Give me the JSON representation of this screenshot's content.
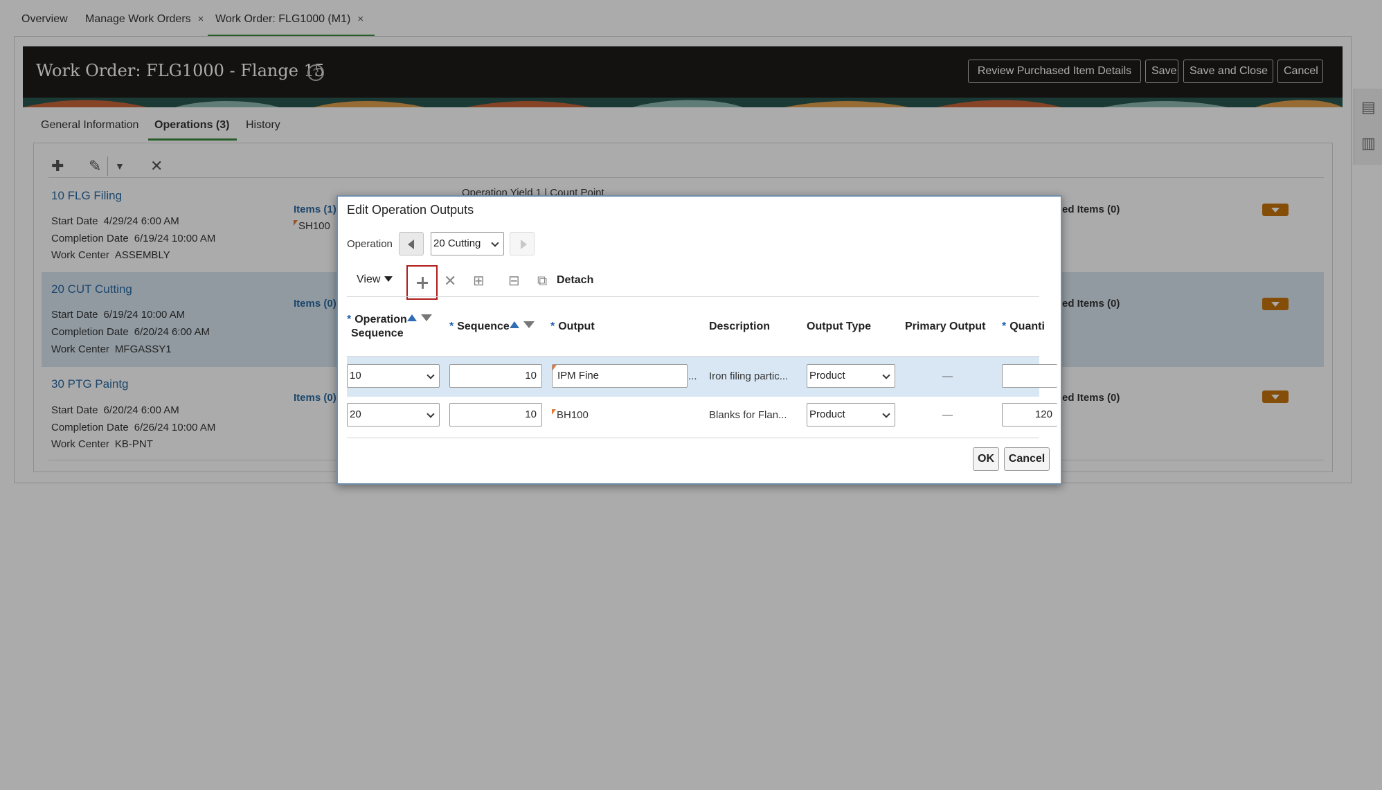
{
  "top_tabs": [
    {
      "label": "Overview"
    },
    {
      "label": "Manage Work Orders",
      "close": "×"
    },
    {
      "label": "Work Order: FLG1000 (M1)",
      "close": "×"
    }
  ],
  "header": {
    "title": "Work Order: FLG1000 - Flange 15",
    "help": "?",
    "buttons": {
      "review": "Review Purchased Item Details",
      "save": "Save",
      "save_close": "Save and Close",
      "cancel": "Cancel"
    }
  },
  "sub_tabs": [
    {
      "label": "General Information"
    },
    {
      "label": "Operations (3)"
    },
    {
      "label": "History"
    }
  ],
  "operations": [
    {
      "name": "10 FLG Filing",
      "start_label": "Start Date",
      "start": "4/29/24 6:00 AM",
      "completion_label": "Completion Date",
      "completion": "6/19/24 10:00 AM",
      "wc_label": "Work Center",
      "wc": "ASSEMBLY",
      "items": "Items (1)",
      "item_code": "SH100",
      "ed_items": "ed Items (0)",
      "yield": "Operation Yield  1  |  Count Point"
    },
    {
      "name": "20 CUT Cutting",
      "start_label": "Start Date",
      "start": "6/19/24 10:00 AM",
      "completion_label": "Completion Date",
      "completion": "6/20/24 6:00 AM",
      "wc_label": "Work Center",
      "wc": "MFGASSY1",
      "items": "Items (0)",
      "ed_items": "ed Items (0)"
    },
    {
      "name": "30 PTG Paintg",
      "start_label": "Start Date",
      "start": "6/20/24 6:00 AM",
      "completion_label": "Completion Date",
      "completion": "6/26/24 10:00 AM",
      "wc_label": "Work Center",
      "wc": "KB-PNT",
      "items": "Items (0)",
      "ed_items": "ed Items (0)"
    }
  ],
  "dialog": {
    "title": "Edit Operation Outputs",
    "operation_label": "Operation",
    "operation_value": "20 Cutting",
    "view_label": "View",
    "detach_label": "Detach",
    "columns": {
      "op_seq_1": "Operation",
      "op_seq_2": "Sequence",
      "sequence": "Sequence",
      "output": "Output",
      "description": "Description",
      "output_type": "Output Type",
      "primary_output": "Primary Output",
      "quantity": "Quanti"
    },
    "rows": [
      {
        "op_seq": "10",
        "sequence": "10",
        "output": "IPM Fine",
        "description": "Iron filing partic...",
        "output_type": "Product",
        "primary": "—",
        "quantity": ""
      },
      {
        "op_seq": "20",
        "sequence": "10",
        "output": "BH100",
        "description": "Blanks for Flan...",
        "output_type": "Product",
        "primary": "—",
        "quantity": "120"
      }
    ],
    "ok": "OK",
    "cancel": "Cancel"
  }
}
